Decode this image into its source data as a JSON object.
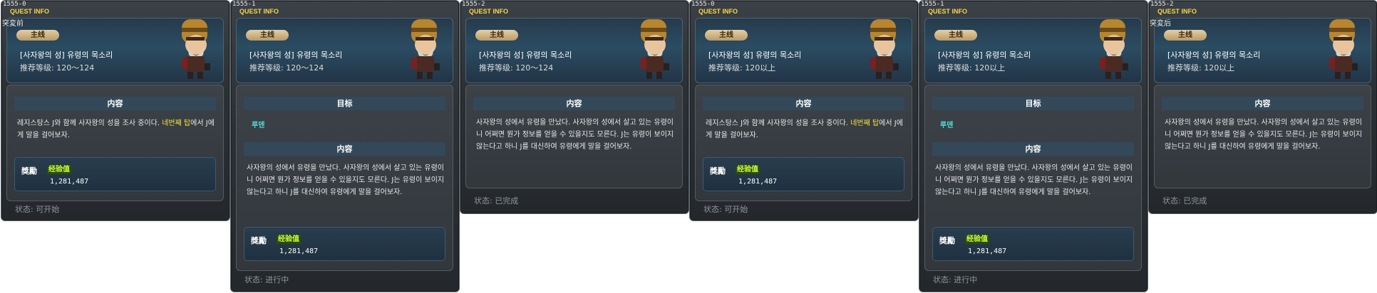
{
  "panels": [
    {
      "code": "1555-0",
      "header": "QUEST INFO",
      "subheader": "突変前",
      "tag": "主线",
      "title": "[사자왕의 성] 유령의 목소리",
      "level": "推荐等级: 120～124",
      "content_heading": "内容",
      "content_parts": [
        "레지스탕스 J와 함께 사자왕의 성을 조사 중이다. ",
        "네번째 탑",
        "에서 J에게 말을 걸어보자."
      ],
      "reward_label": "獎勵",
      "reward_badge": "经验值",
      "reward_amount": "1,281,487",
      "status": "状态: 可开始"
    },
    {
      "code": "1555-1",
      "header": "QUEST INFO",
      "tag": "主线",
      "title": "[사자왕의 성] 유령의 목소리",
      "level": "推荐等级: 120～124",
      "target_heading": "目标",
      "target": "루덴",
      "content_heading": "内容",
      "content": "사자왕의 성에서 유령을 만났다. 사자왕의 성에서 살고 있는 유령이니 어쩌면 뭔가 정보를 얻을 수 있을지도 모른다. J는 유령이 보이지 않는다고 하니 J를 대신하여 유령에게 말을 걸어보자.",
      "reward_label": "獎勵",
      "reward_badge": "经验值",
      "reward_amount": "1,281,487",
      "status": "状态: 进行中"
    },
    {
      "code": "1555-2",
      "header": "QUEST INFO",
      "tag": "主线",
      "title": "[사자왕의 성] 유령의 목소리",
      "level": "推荐等级: 120～124",
      "content_heading": "内容",
      "content": "사자왕의 성에서 유령을 만났다. 사자왕의 성에서 살고 있는 유령이니 어쩌면 뭔가 정보를 얻을 수 있을지도 모른다. J는 유령이 보이지 않는다고 하니 J를 대신하여 유령에게 말을 걸어보자.",
      "status": "状态: 已完成"
    },
    {
      "code": "1555-0",
      "header": "QUEST INFO",
      "tag": "主线",
      "title": "[사자왕의 성] 유령의 목소리",
      "level": "推荐等级: 120以上",
      "content_heading": "内容",
      "content_parts": [
        "레지스탕스 J와 함께 사자왕의 성을 조사 중이다. ",
        "네번째 탑",
        "에서 J에게 말을 걸어보자."
      ],
      "reward_label": "獎勵",
      "reward_badge": "经验值",
      "reward_amount": "1,281,487",
      "status": "状态: 可开始"
    },
    {
      "code": "1555-1",
      "header": "QUEST INFO",
      "tag": "主线",
      "title": "[사자왕의 성] 유령의 목소리",
      "level": "推荐等级: 120以上",
      "target_heading": "目标",
      "target": "루덴",
      "content_heading": "内容",
      "content": "사자왕의 성에서 유령을 만났다. 사자왕의 성에서 살고 있는 유령이니 어쩌면 뭔가 정보를 얻을 수 있을지도 모른다. J는 유령이 보이지 않는다고 하니 J를 대신하여 유령에게 말을 걸어보자.",
      "reward_label": "獎勵",
      "reward_badge": "经验值",
      "reward_amount": "1,281,487",
      "status": "状态: 进行中"
    },
    {
      "code": "1555-2",
      "header": "QUEST INFO",
      "subheader": "突変后",
      "tag": "主线",
      "title": "[사자왕의 성] 유령의 목소리",
      "level": "推荐等级: 120以上",
      "content_heading": "内容",
      "content": "사자왕의 성에서 유령을 만났다. 사자왕의 성에서 살고 있는 유령이니 어쩌면 뭔가 정보를 얻을 수 있을지도 모른다. J는 유령이 보이지 않는다고 하니 J를 대신하여 유령에게 말을 걸어보자.",
      "status": "状态: 已完成"
    }
  ]
}
